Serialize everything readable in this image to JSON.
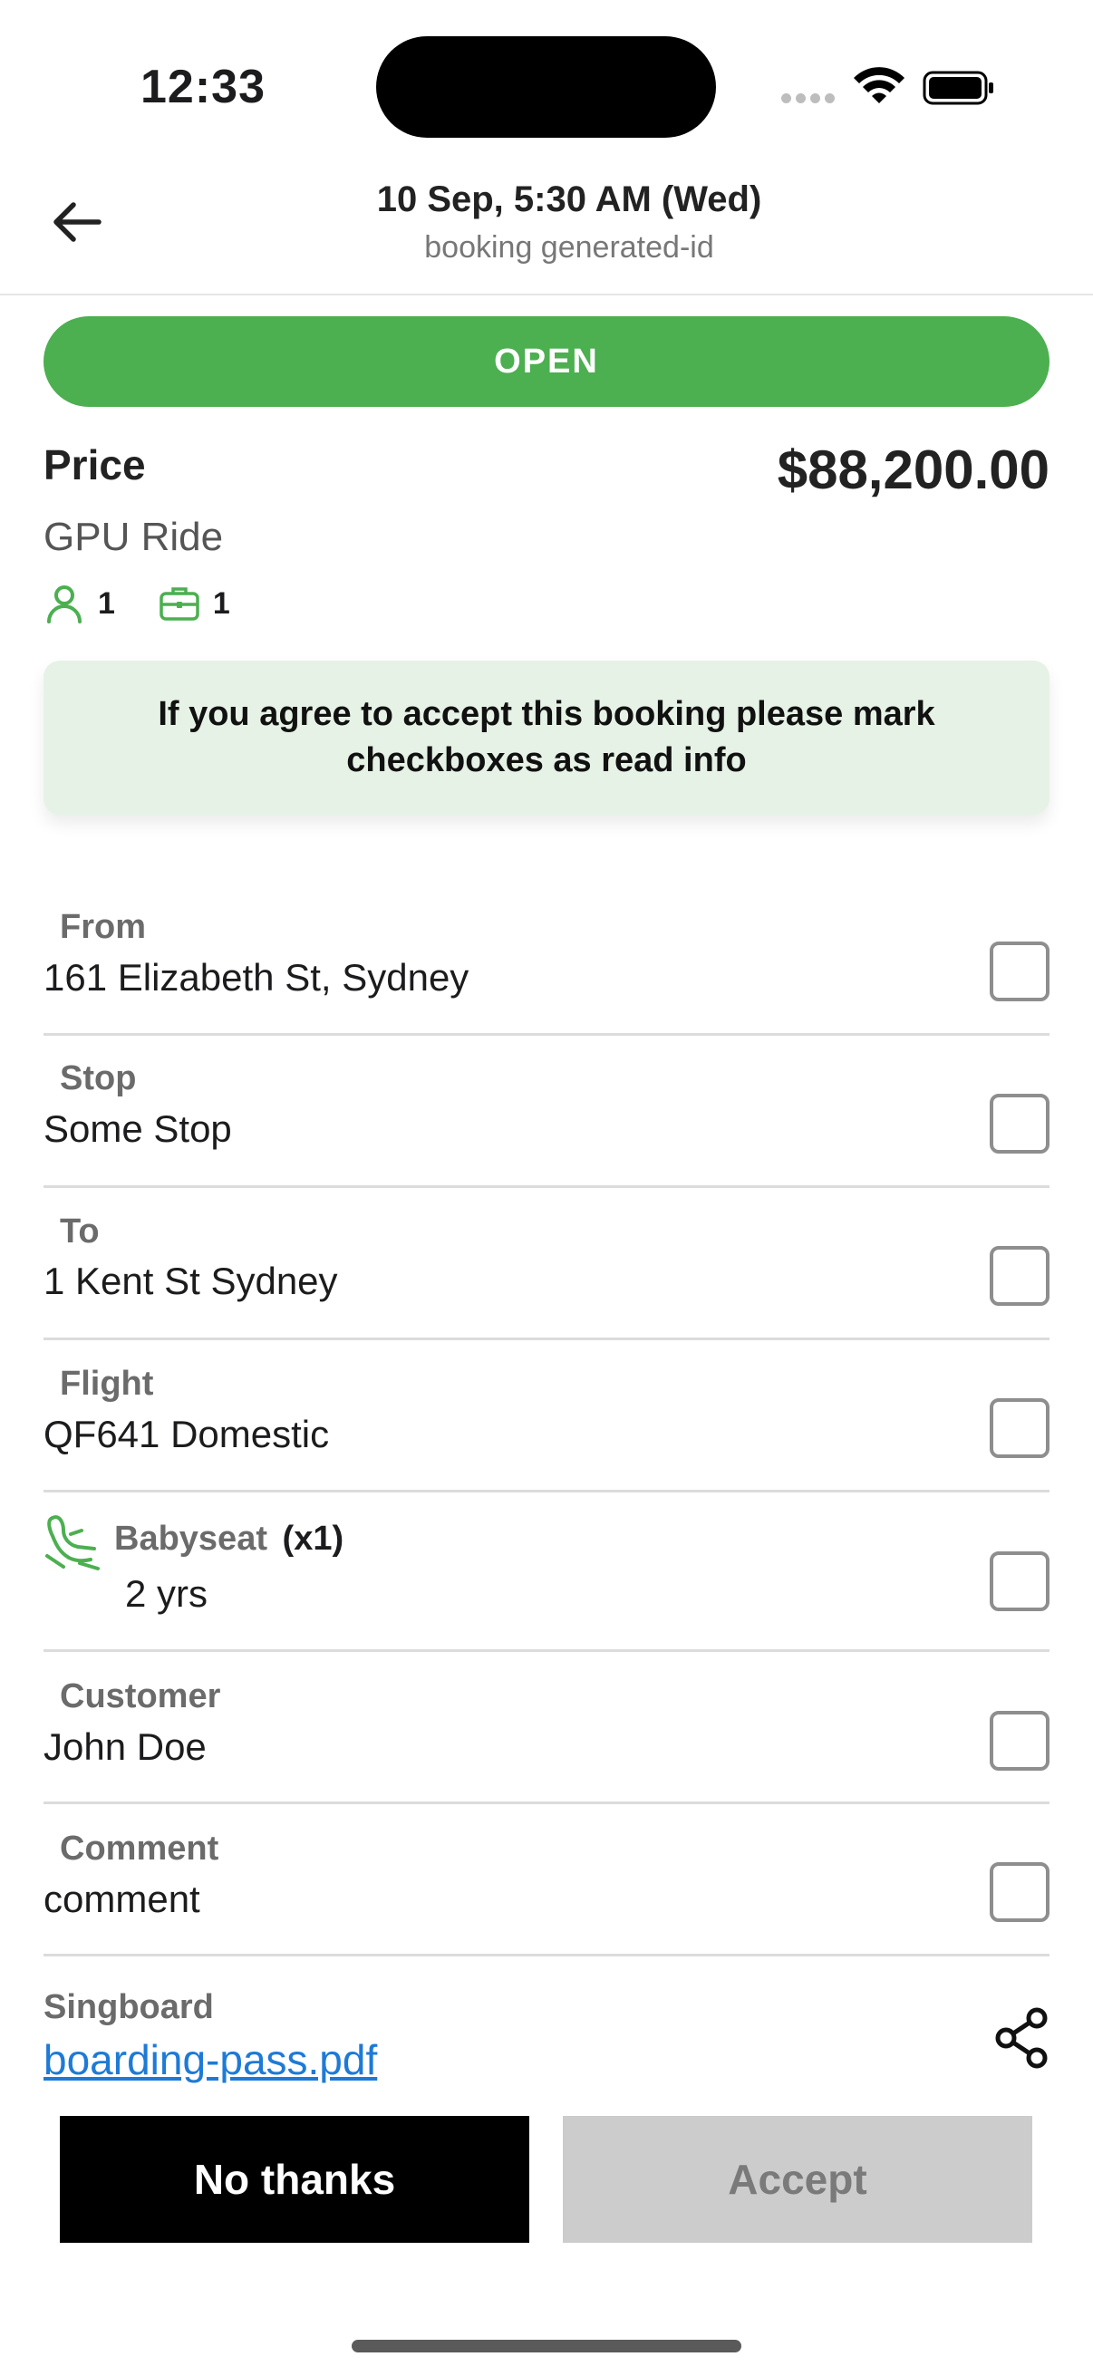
{
  "status_bar": {
    "time": "12:33"
  },
  "header": {
    "title": "10 Sep, 5:30 AM (Wed)",
    "subtitle": "booking generated-id"
  },
  "status": "OPEN",
  "price": {
    "label": "Price",
    "value": "$88,200.00",
    "ride_type": "GPU Ride",
    "passengers": "1",
    "luggage": "1"
  },
  "notice": "If you agree to accept this booking please mark checkboxes as read info",
  "rows": {
    "from": {
      "label": "From",
      "value": "161 Elizabeth St, Sydney",
      "checked": false
    },
    "stop": {
      "label": "Stop",
      "value": "Some Stop",
      "checked": false
    },
    "to": {
      "label": "To",
      "value": "1 Kent St Sydney",
      "checked": false
    },
    "flight": {
      "label": "Flight",
      "value": "QF641 Domestic",
      "checked": false
    },
    "babyseat": {
      "label": "Babyseat",
      "quantity": "(x1)",
      "value": "2 yrs",
      "checked": false
    },
    "customer": {
      "label": "Customer",
      "value": "John Doe",
      "checked": false
    },
    "comment": {
      "label": "Comment",
      "value": "comment",
      "checked": false
    }
  },
  "signboard": {
    "label": "Singboard",
    "file": "boarding-pass.pdf"
  },
  "actions": {
    "decline": "No thanks",
    "accept": "Accept"
  },
  "colors": {
    "status_green": "#4caf50",
    "icon_green": "#4caf50",
    "notice_bg": "#e6f2e6",
    "link_blue": "#1e7ad6",
    "accept_disabled": "#cccccc"
  }
}
